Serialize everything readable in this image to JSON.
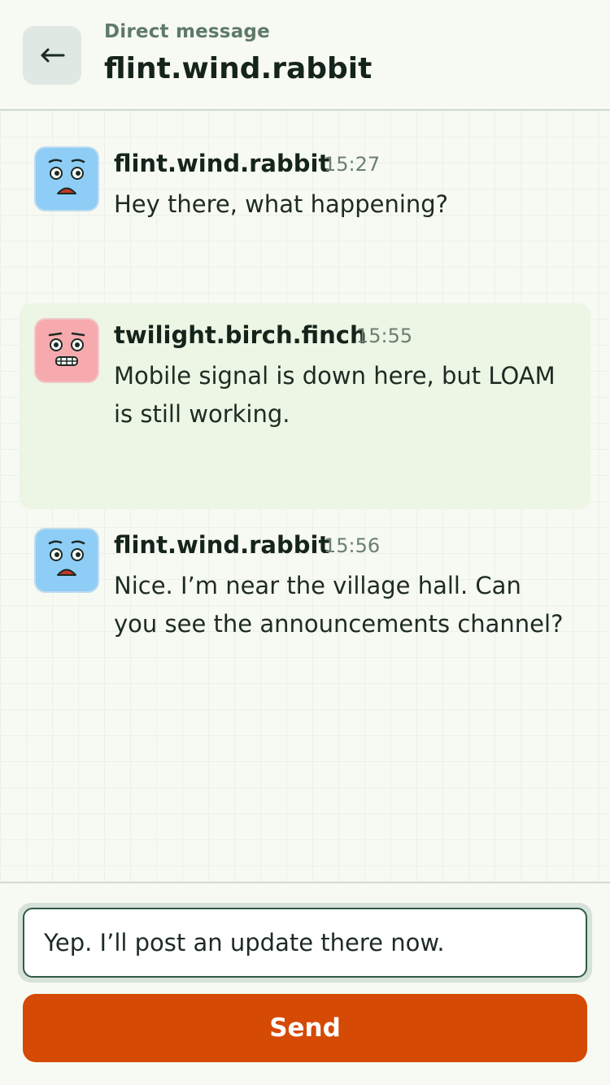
{
  "header": {
    "subtitle": "Direct message",
    "title": "flint.wind.rabbit",
    "back_icon": "arrow-left-icon"
  },
  "messages": [
    {
      "author": "flint.wind.rabbit",
      "time": "15:27",
      "text": "Hey there, what happening?",
      "avatar_color": "#8ecdf6",
      "avatar_icon": "worried-face-icon",
      "highlighted": false
    },
    {
      "author": "twilight.birch.finch",
      "time": "15:55",
      "text": "Mobile signal is down here, but LOAM is still working.",
      "avatar_color": "#f7aaae",
      "avatar_icon": "grimace-face-icon",
      "highlighted": true
    },
    {
      "author": "flint.wind.rabbit",
      "time": "15:56",
      "text": "Nice. I’m near the village hall. Can you see the announcements channel?",
      "avatar_color": "#8ecdf6",
      "avatar_icon": "worried-face-icon",
      "highlighted": false
    }
  ],
  "composer": {
    "input_value": "Yep. I’ll post an update there now.",
    "send_label": "Send"
  },
  "colors": {
    "accent": "#d54a04",
    "highlight_bg": "#edf5e4",
    "input_border": "#2f5a48"
  }
}
